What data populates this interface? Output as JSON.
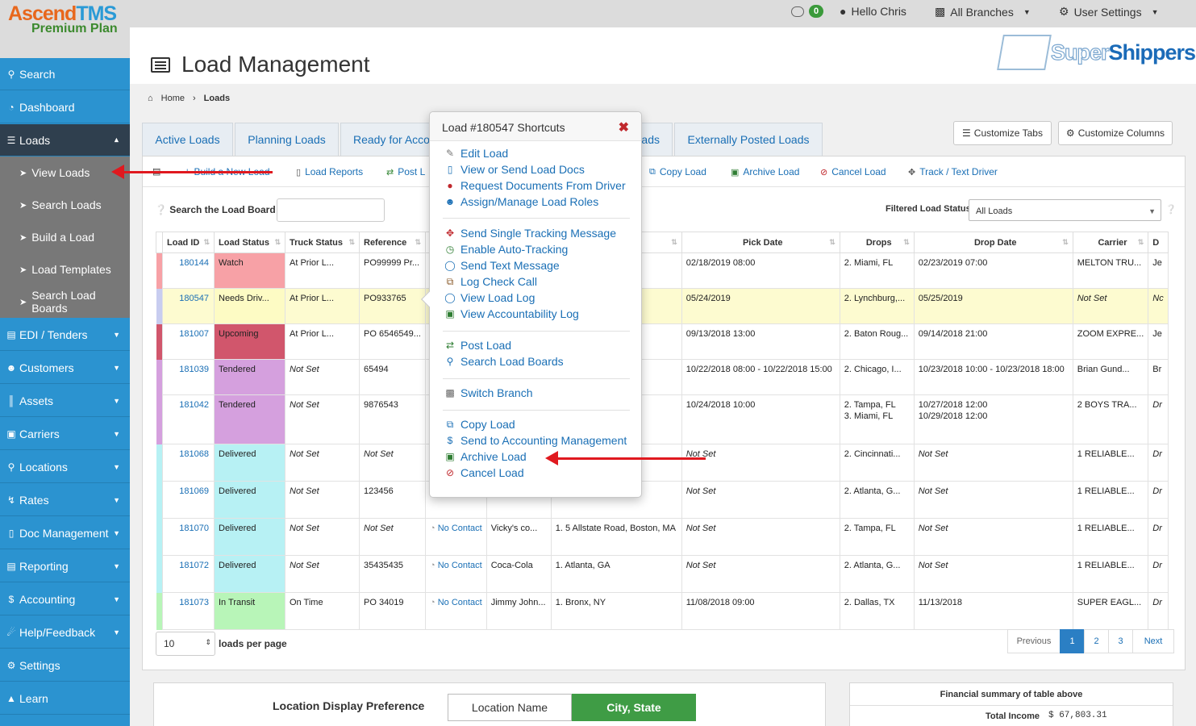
{
  "brand": {
    "name_a": "Ascend",
    "name_b": "TMS",
    "plan": "Premium Plan"
  },
  "topbar": {
    "message_count": "0",
    "greeting": "Hello Chris",
    "branches": "All Branches",
    "user_settings": "User Settings"
  },
  "sidebar": {
    "items": [
      {
        "label": "Search",
        "icon": "search-icon"
      },
      {
        "label": "Dashboard",
        "icon": "dashboard-icon"
      },
      {
        "label": "Loads",
        "icon": "list-icon"
      },
      {
        "label": "EDI / Tenders",
        "icon": "edi-icon"
      },
      {
        "label": "Customers",
        "icon": "users-icon"
      },
      {
        "label": "Assets",
        "icon": "barcode-icon"
      },
      {
        "label": "Carriers",
        "icon": "truck-icon"
      },
      {
        "label": "Locations",
        "icon": "map-marker-icon"
      },
      {
        "label": "Rates",
        "icon": "bolt-icon"
      },
      {
        "label": "Doc Management",
        "icon": "file-icon"
      },
      {
        "label": "Reporting",
        "icon": "report-icon"
      },
      {
        "label": "Accounting",
        "icon": "dollar-icon"
      },
      {
        "label": "Help/Feedback",
        "icon": "megaphone-icon"
      },
      {
        "label": "Settings",
        "icon": "cogs-icon"
      },
      {
        "label": "Learn",
        "icon": "graduation-cap-icon"
      }
    ],
    "sub_items": [
      "View Loads",
      "Search Loads",
      "Build a Load",
      "Load Templates",
      "Search Load Boards"
    ]
  },
  "page": {
    "title": "Load Management",
    "partner_logo_a": "Super",
    "partner_logo_b": "Shippers"
  },
  "breadcrumb": {
    "home": "Home",
    "current": "Loads"
  },
  "tabs": [
    "Active Loads",
    "Planning Loads",
    "Ready for Acco",
    "ads",
    "Externally Posted Loads"
  ],
  "tab_buttons": {
    "customize_tabs": "Customize Tabs",
    "customize_columns": "Customize Columns"
  },
  "toolbar": {
    "build": "Build a New Load",
    "reports": "Load Reports",
    "post": "Post L",
    "copy": "Copy Load",
    "archive": "Archive Load",
    "cancel": "Cancel Load",
    "track": "Track / Text Driver"
  },
  "search": {
    "label": "Search the Load Board",
    "filter_label": "Filtered Load Status",
    "filter_value": "All Loads"
  },
  "table": {
    "headers": [
      "Load ID",
      "Load Status",
      "Truck Status",
      "Reference",
      "L",
      "",
      "",
      "Pick Date",
      "Drops",
      "Drop Date",
      "Carrier",
      "D"
    ],
    "rows": [
      {
        "id": "180144",
        "status": "Watch",
        "truck": "At Prior L...",
        "ref": "PO99999 Pr...",
        "contact": "",
        "cust": "",
        "pick_loc": "",
        "pick_date": "02/18/2019 08:00",
        "drops": "2. Miami, FL",
        "drops2": "",
        "drop_date": "02/23/2019 07:00",
        "drop_date2": "",
        "carrier": "MELTON TRU...",
        "d": "Je"
      },
      {
        "id": "180547",
        "status": "Needs Driv...",
        "truck": "At Prior L...",
        "ref": "PO933765",
        "contact": "",
        "cust": "",
        "pick_loc": "",
        "pick_date": "05/24/2019",
        "drops": "2. Lynchburg,...",
        "drops2": "",
        "drop_date": "05/25/2019",
        "drop_date2": "",
        "carrier": "Not Set",
        "d": "Nc"
      },
      {
        "id": "181007",
        "status": "Upcoming",
        "truck": "At Prior L...",
        "ref": "PO 6546549...",
        "contact": "",
        "cust": "",
        "pick_loc": "",
        "pick_date": "09/13/2018 13:00",
        "drops": "2. Baton Roug...",
        "drops2": "",
        "drop_date": "09/14/2018 21:00",
        "drop_date2": "",
        "carrier": "ZOOM EXPRE...",
        "d": "Je"
      },
      {
        "id": "181039",
        "status": "Tendered",
        "truck": "Not Set",
        "ref": "65494",
        "contact": "",
        "cust": "",
        "pick_loc": "",
        "pick_date": "10/22/2018 08:00 - 10/22/2018 15:00",
        "drops": "2. Chicago, I...",
        "drops2": "",
        "drop_date": "10/23/2018 10:00 - 10/23/2018 18:00",
        "drop_date2": "",
        "carrier": "Brian Gund...",
        "d": "Br"
      },
      {
        "id": "181042",
        "status": "Tendered",
        "truck": "Not Set",
        "ref": "9876543",
        "contact": "",
        "cust": "",
        "pick_loc": "",
        "pick_date": "10/24/2018 10:00",
        "drops": "2. Tampa, FL",
        "drops2": "3. Miami, FL",
        "drop_date": "10/27/2018 12:00",
        "drop_date2": "10/29/2018 12:00",
        "carrier": "2 BOYS TRA...",
        "d": "Dr"
      },
      {
        "id": "181068",
        "status": "Delivered",
        "truck": "Not Set",
        "ref": "Not Set",
        "contact": "",
        "cust": "",
        "pick_loc": "Boston, MA",
        "pick_date": "Not Set",
        "drops": "2. Cincinnati...",
        "drops2": "",
        "drop_date": "Not Set",
        "drop_date2": "",
        "carrier": "1 RELIABLE...",
        "d": "Dr"
      },
      {
        "id": "181069",
        "status": "Delivered",
        "truck": "Not Set",
        "ref": "123456",
        "contact": "",
        "cust": "",
        "pick_loc": "",
        "pick_date": "Not Set",
        "drops": "2. Atlanta, G...",
        "drops2": "",
        "drop_date": "Not Set",
        "drop_date2": "",
        "carrier": "1 RELIABLE...",
        "d": "Dr"
      },
      {
        "id": "181070",
        "status": "Delivered",
        "truck": "Not Set",
        "ref": "Not Set",
        "contact": "No Contact",
        "cust": "Vicky's co...",
        "pick_loc": "1. 5 Allstate Road, Boston, MA",
        "pick_date": "Not Set",
        "drops": "2. Tampa, FL",
        "drops2": "",
        "drop_date": "Not Set",
        "drop_date2": "",
        "carrier": "1 RELIABLE...",
        "d": "Dr"
      },
      {
        "id": "181072",
        "status": "Delivered",
        "truck": "Not Set",
        "ref": "35435435",
        "contact": "No Contact",
        "cust": "Coca-Cola",
        "pick_loc": "1. Atlanta, GA",
        "pick_date": "Not Set",
        "drops": "2. Atlanta, G...",
        "drops2": "",
        "drop_date": "Not Set",
        "drop_date2": "",
        "carrier": "1 RELIABLE...",
        "d": "Dr"
      },
      {
        "id": "181073",
        "status": "In Transit",
        "truck": "On Time",
        "ref": "PO 34019",
        "contact": "No Contact",
        "cust": "Jimmy John...",
        "pick_loc": "1. Bronx, NY",
        "pick_date": "11/08/2018 09:00",
        "drops": "2. Dallas, TX",
        "drops2": "",
        "drop_date": "11/13/2018",
        "drop_date2": "",
        "carrier": "SUPER EAGL...",
        "d": "Dr"
      }
    ]
  },
  "pagination": {
    "per_page": "10",
    "per_page_label": "loads per page",
    "previous": "Previous",
    "pages": [
      "1",
      "2",
      "3"
    ],
    "next": "Next"
  },
  "bottom": {
    "location_pref": "Location Display Preference",
    "opt_name": "Location Name",
    "opt_city": "City, State",
    "financial_title": "Financial summary of table above",
    "total_income_label": "Total Income",
    "total_income_value": "$ 67,803.31"
  },
  "popover": {
    "title": "Load #180547 Shortcuts",
    "groups": [
      [
        "Edit Load",
        "View or Send Load Docs",
        "Request Documents From Driver",
        "Assign/Manage Load Roles"
      ],
      [
        "Send Single Tracking Message",
        "Enable Auto-Tracking",
        "Send Text Message",
        "Log Check Call",
        "View Load Log",
        "View Accountability Log"
      ],
      [
        "Post Load",
        "Search Load Boards"
      ],
      [
        "Switch Branch"
      ],
      [
        "Copy Load",
        "Send to Accounting Management",
        "Archive Load",
        "Cancel Load"
      ]
    ]
  }
}
